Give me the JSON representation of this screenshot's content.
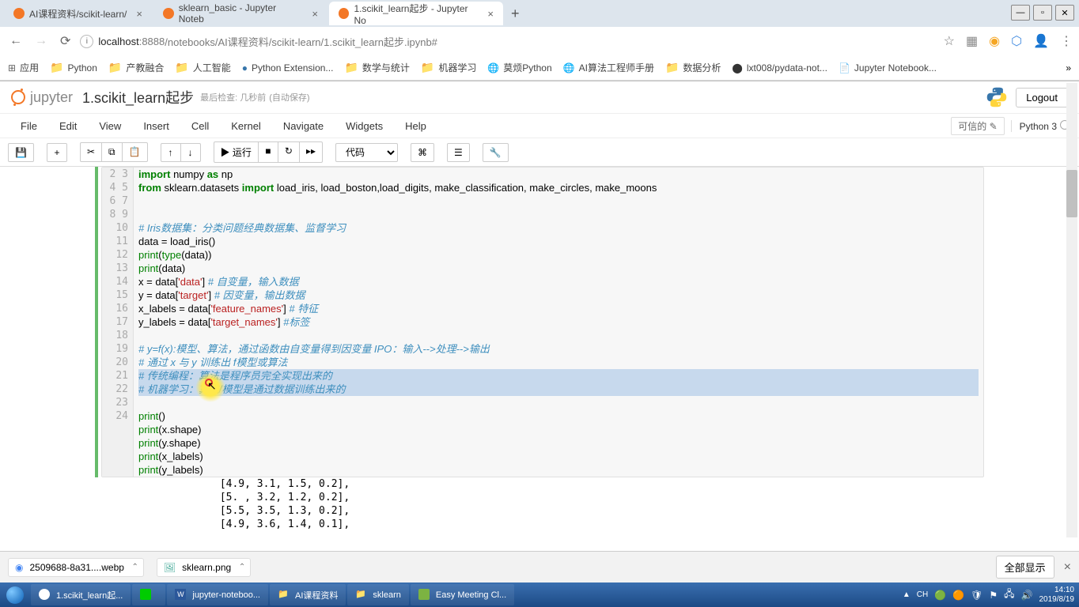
{
  "browser": {
    "tabs": [
      {
        "title": "AI课程资料/scikit-learn/",
        "active": false
      },
      {
        "title": "sklearn_basic - Jupyter Noteb",
        "active": false
      },
      {
        "title": "1.scikit_learn起步 - Jupyter No",
        "active": true
      }
    ],
    "url_host": "localhost",
    "url_port": ":8888",
    "url_path": "/notebooks/AI课程资料/scikit-learn/1.scikit_learn起步.ipynb#",
    "bookmarks": [
      {
        "label": "应用",
        "icon": "apps"
      },
      {
        "label": "Python",
        "icon": "folder"
      },
      {
        "label": "产教融合",
        "icon": "folder"
      },
      {
        "label": "人工智能",
        "icon": "folder"
      },
      {
        "label": "Python Extension...",
        "icon": "python"
      },
      {
        "label": "数学与统计",
        "icon": "folder"
      },
      {
        "label": "机器学习",
        "icon": "folder"
      },
      {
        "label": "莫烦Python",
        "icon": "web"
      },
      {
        "label": "AI算法工程师手册",
        "icon": "web"
      },
      {
        "label": "数据分析",
        "icon": "folder"
      },
      {
        "label": "lxt008/pydata-not...",
        "icon": "github"
      },
      {
        "label": "Jupyter Notebook...",
        "icon": "page"
      }
    ]
  },
  "jupyter": {
    "brand": "jupyter",
    "title": "1.scikit_learn起步",
    "last_check": "最后检查: 几秒前",
    "autosave": "(自动保存)",
    "logout": "Logout",
    "trusted": "可信的",
    "kernel": "Python 3",
    "menus": [
      "File",
      "Edit",
      "View",
      "Insert",
      "Cell",
      "Kernel",
      "Navigate",
      "Widgets",
      "Help"
    ],
    "run_label": "运行",
    "cell_type": "代码"
  },
  "code": {
    "lines": [
      {
        "n": 2,
        "tokens": [
          {
            "t": "import",
            "c": "kw"
          },
          {
            "t": " numpy "
          },
          {
            "t": "as",
            "c": "kw"
          },
          {
            "t": " np"
          }
        ]
      },
      {
        "n": 3,
        "tokens": [
          {
            "t": "from",
            "c": "kw"
          },
          {
            "t": " sklearn.datasets "
          },
          {
            "t": "import",
            "c": "kw"
          },
          {
            "t": " load_iris, load_boston,load_digits, make_classification, make_circles, make_moons"
          }
        ]
      },
      {
        "n": 4,
        "tokens": []
      },
      {
        "n": 5,
        "tokens": []
      },
      {
        "n": 6,
        "tokens": [
          {
            "t": "# Iris数据集：分类问题经典数据集、监督学习",
            "c": "com"
          }
        ]
      },
      {
        "n": 7,
        "tokens": [
          {
            "t": "data = load_iris()"
          }
        ]
      },
      {
        "n": 8,
        "tokens": [
          {
            "t": "print",
            "c": "builtin"
          },
          {
            "t": "("
          },
          {
            "t": "type",
            "c": "builtin"
          },
          {
            "t": "(data))"
          }
        ]
      },
      {
        "n": 9,
        "tokens": [
          {
            "t": "print",
            "c": "builtin"
          },
          {
            "t": "(data)"
          }
        ]
      },
      {
        "n": 10,
        "tokens": [
          {
            "t": "x = data["
          },
          {
            "t": "'data'",
            "c": "str"
          },
          {
            "t": "] "
          },
          {
            "t": "# 自变量，输入数据",
            "c": "com"
          }
        ]
      },
      {
        "n": 11,
        "tokens": [
          {
            "t": "y = data["
          },
          {
            "t": "'target'",
            "c": "str"
          },
          {
            "t": "] "
          },
          {
            "t": "# 因变量，输出数据",
            "c": "com"
          }
        ]
      },
      {
        "n": 12,
        "tokens": [
          {
            "t": "x_labels = data["
          },
          {
            "t": "'feature_names'",
            "c": "str"
          },
          {
            "t": "] "
          },
          {
            "t": "# 特征",
            "c": "com"
          }
        ]
      },
      {
        "n": 13,
        "tokens": [
          {
            "t": "y_labels = data["
          },
          {
            "t": "'target_names'",
            "c": "str"
          },
          {
            "t": "] "
          },
          {
            "t": "#标签",
            "c": "com"
          }
        ]
      },
      {
        "n": 14,
        "tokens": []
      },
      {
        "n": 15,
        "tokens": [
          {
            "t": "# y=f(x):模型、算法，通过函数由自变量得到因变量 IPO：输入-->处理-->输出",
            "c": "com"
          }
        ]
      },
      {
        "n": 16,
        "tokens": [
          {
            "t": "# 通过 x 与 y 训练出 f模型或算法",
            "c": "com"
          }
        ]
      },
      {
        "n": 17,
        "sel": true,
        "tokens": [
          {
            "t": "# 传统编程：算法是程序员完全实现出来的",
            "c": "com"
          }
        ]
      },
      {
        "n": 18,
        "sel": true,
        "tokens": [
          {
            "t": "# 机器学习：算法/模型是通过数据训练出来的",
            "c": "com"
          }
        ]
      },
      {
        "n": 19,
        "tokens": []
      },
      {
        "n": 20,
        "tokens": [
          {
            "t": "print",
            "c": "builtin"
          },
          {
            "t": "()"
          }
        ]
      },
      {
        "n": 21,
        "tokens": [
          {
            "t": "print",
            "c": "builtin"
          },
          {
            "t": "(x.shape)"
          }
        ]
      },
      {
        "n": 22,
        "tokens": [
          {
            "t": "print",
            "c": "builtin"
          },
          {
            "t": "(y.shape)"
          }
        ]
      },
      {
        "n": 23,
        "tokens": [
          {
            "t": "print",
            "c": "builtin"
          },
          {
            "t": "(x_labels)"
          }
        ]
      },
      {
        "n": 24,
        "tokens": [
          {
            "t": "print",
            "c": "builtin"
          },
          {
            "t": "(y_labels)"
          }
        ]
      }
    ],
    "output": [
      "[4.9, 3.1, 1.5, 0.2],",
      "[5. , 3.2, 1.2, 0.2],",
      "[5.5, 3.5, 1.3, 0.2],",
      "[4.9, 3.6, 1.4, 0.1],"
    ]
  },
  "downloads": [
    {
      "name": "2509688-8a31....webp",
      "icon": "chrome"
    },
    {
      "name": "sklearn.png",
      "icon": "image"
    }
  ],
  "dl_show": "全部显示",
  "taskbar": {
    "items": [
      {
        "label": "1.scikit_learn起...",
        "icon": "chrome"
      },
      {
        "label": "",
        "icon": "iqiyi"
      },
      {
        "label": "jupyter-noteboo...",
        "icon": "word"
      },
      {
        "label": "AI课程资料",
        "icon": "folder"
      },
      {
        "label": "sklearn",
        "icon": "folder"
      },
      {
        "label": "Easy Meeting Cl...",
        "icon": "app"
      }
    ],
    "time": "14:10",
    "date": "2019/8/19",
    "lang": "CH"
  }
}
